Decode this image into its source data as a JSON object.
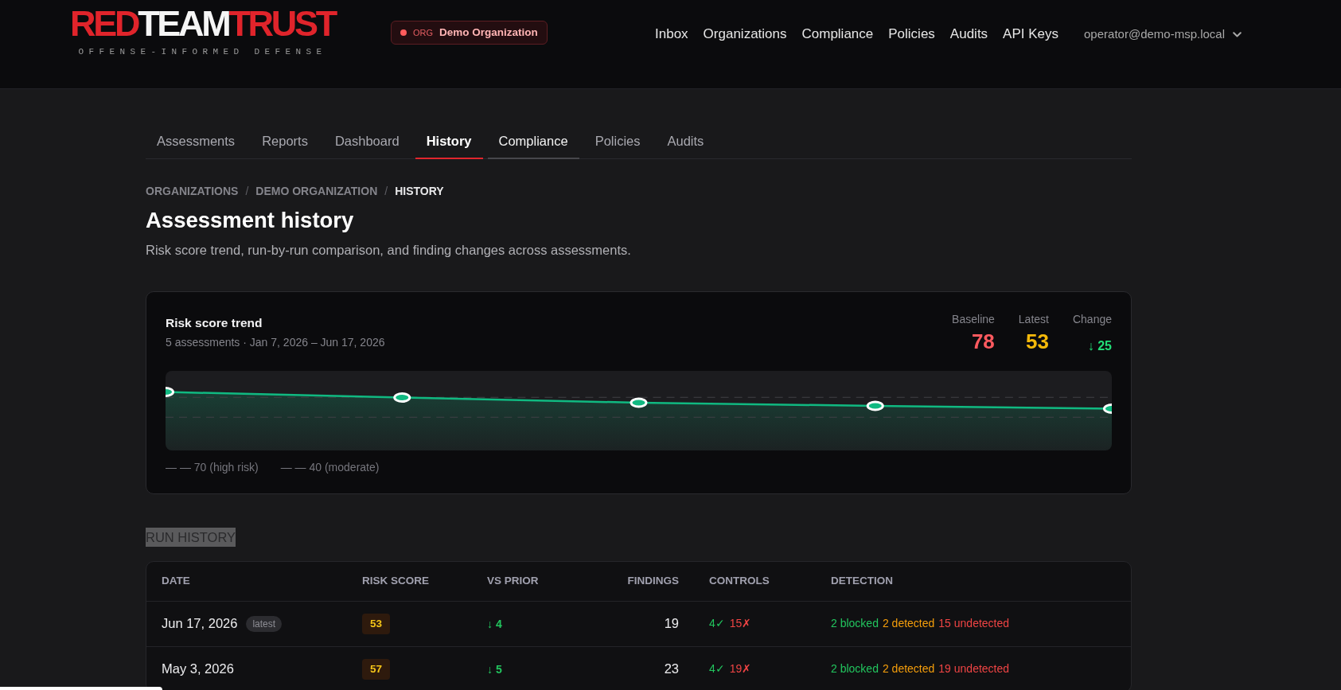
{
  "header": {
    "logo": {
      "parts": [
        {
          "text": "RED",
          "kind": "accent"
        },
        {
          "text": "TEAM",
          "kind": "plain"
        },
        {
          "text": "TRUST",
          "kind": "accent"
        }
      ],
      "tagline": "OFFENSE-INFORMED DEFENSE"
    },
    "org_badge": {
      "tag": "ORG",
      "name": "Demo Organization"
    },
    "nav": [
      {
        "label": "Inbox"
      },
      {
        "label": "Organizations"
      },
      {
        "label": "Compliance"
      },
      {
        "label": "Policies"
      },
      {
        "label": "Audits"
      },
      {
        "label": "API Keys"
      }
    ],
    "user_menu": {
      "label": "operator@demo-msp.local"
    }
  },
  "tabs": [
    {
      "label": "Assessments",
      "selected": false,
      "hovered": false
    },
    {
      "label": "Reports",
      "selected": false,
      "hovered": false
    },
    {
      "label": "Dashboard",
      "selected": false,
      "hovered": false
    },
    {
      "label": "History",
      "selected": true,
      "hovered": false
    },
    {
      "label": "Compliance",
      "selected": false,
      "hovered": true
    },
    {
      "label": "Policies",
      "selected": false,
      "hovered": false
    },
    {
      "label": "Audits",
      "selected": false,
      "hovered": false
    }
  ],
  "breadcrumb": [
    {
      "label": "ORGANIZATIONS",
      "current": false,
      "separator": "/"
    },
    {
      "label": "DEMO ORGANIZATION",
      "current": false,
      "separator": "/"
    },
    {
      "label": "HISTORY",
      "current": true
    }
  ],
  "page": {
    "title": "Assessment history",
    "subtitle": "Risk score trend, run-by-run comparison, and finding changes across assessments."
  },
  "trend_card": {
    "title": "Risk score trend",
    "subtitle": "5 assessments · Jan 7, 2026 – Jun 17, 2026",
    "stats": [
      {
        "label": "Baseline",
        "value": "78",
        "kind": "score",
        "color": "#ff5a5f"
      },
      {
        "label": "Latest",
        "value": "53",
        "kind": "score",
        "color": "#f5b90a"
      },
      {
        "label": "Change",
        "value": "↓ 25",
        "kind": "delta",
        "color": "#22dd77"
      }
    ],
    "legend": [
      "— — 70 (high risk)",
      "— — 40 (moderate)"
    ]
  },
  "run_history": {
    "heading": "RUN HISTORY",
    "highlighted": true,
    "columns": [
      "DATE",
      "RISK SCORE",
      "VS PRIOR",
      "FINDINGS",
      "CONTROLS",
      "DETECTION"
    ],
    "rows": [
      {
        "date": "Jun 17, 2026",
        "badge": "latest",
        "risk_score": "53",
        "vs_prior": "↓ 4",
        "findings": "19",
        "controls": {
          "passed": "4✓",
          "failed": "15✗"
        },
        "detection": {
          "blocked": "2 blocked",
          "detected": "2 detected",
          "undetected": "15 undetected"
        }
      },
      {
        "date": "May 3, 2026",
        "risk_score": "57",
        "vs_prior": "↓ 5",
        "findings": "23",
        "controls": {
          "passed": "4✓",
          "failed": "19✗"
        },
        "detection": {
          "blocked": "2 blocked",
          "detected": "2 detected",
          "undetected": "19 undetected"
        }
      }
    ]
  }
}
